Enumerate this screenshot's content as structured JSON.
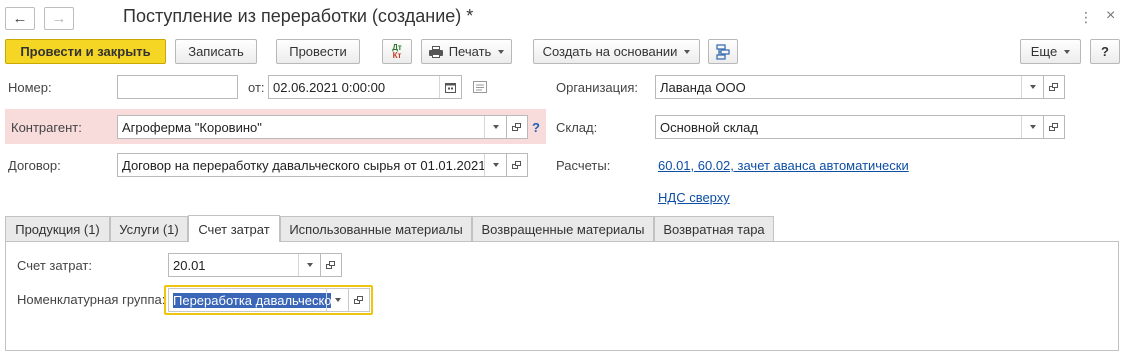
{
  "window": {
    "title": "Поступление из переработки (создание) *",
    "nav_back_icon": "arrow-left",
    "nav_forward_icon": "arrow-right",
    "more_icon": "⋮",
    "close_icon": "×"
  },
  "toolbar": {
    "post_and_close": "Провести и закрыть",
    "save": "Записать",
    "post": "Провести",
    "dt_kt_top": "Дт",
    "dt_kt_bottom": "Кт",
    "print": "Печать",
    "create_based_on": "Создать на основании",
    "more": "Еще",
    "help": "?"
  },
  "header": {
    "number_label": "Номер:",
    "number_value": "",
    "date_from_label": "от:",
    "date_value": "02.06.2021  0:00:00",
    "organization_label": "Организация:",
    "organization_value": "Лаванда ООО",
    "counterparty_label": "Контрагент:",
    "counterparty_value": "Агроферма \"Коровино\"",
    "counterparty_help": "?",
    "warehouse_label": "Склад:",
    "warehouse_value": "Основной склад",
    "contract_label": "Договор:",
    "contract_value": "Договор на переработку давальческого сырья от 01.01.2021",
    "settlements_label": "Расчеты:",
    "settlements_link": "60.01, 60.02, зачет аванса автоматически",
    "vat_link": "НДС сверху"
  },
  "tabs": [
    {
      "label": "Продукция (1)",
      "active": false
    },
    {
      "label": "Услуги (1)",
      "active": false
    },
    {
      "label": "Счет затрат",
      "active": true
    },
    {
      "label": "Использованные материалы",
      "active": false
    },
    {
      "label": "Возвращенные материалы",
      "active": false
    },
    {
      "label": "Возвратная тара",
      "active": false
    }
  ],
  "cost_tab": {
    "cost_account_label": "Счет затрат:",
    "cost_account_value": "20.01",
    "nomenclature_group_label": "Номенклатурная группа:",
    "nomenclature_group_value": "Переработка давальческо"
  },
  "colors": {
    "primary_button": "#f6d624",
    "error_highlight": "#f8dcdc",
    "link": "#0e4fa6",
    "focus_border": "#f1c40f",
    "selection": "#3a66b8"
  }
}
